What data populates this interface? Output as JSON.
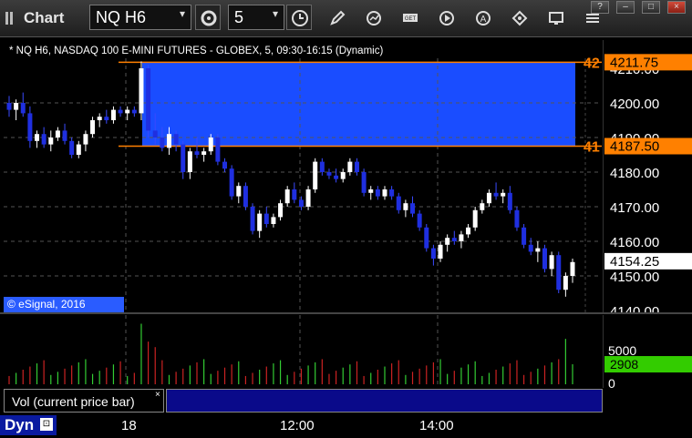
{
  "toolbar": {
    "title": "Chart",
    "symbol": "NQ H6",
    "interval": "5",
    "icons": [
      "settings-gear-icon",
      "clock-icon",
      "pencil-icon",
      "refresh-icon",
      "get-icon",
      "play-icon",
      "alert-icon",
      "tag-icon",
      "monitor-icon",
      "list-icon"
    ]
  },
  "window_buttons": [
    "?",
    "–",
    "□",
    "×"
  ],
  "chart_header": "* NQ H6, NASDAQ 100 E-MINI FUTURES - GLOBEX, 5, 09:30-16:15 (Dynamic)",
  "copyright": "© eSignal, 2016",
  "price_axis": {
    "ticks": [
      "4210.00",
      "4200.00",
      "4190.00",
      "4180.00",
      "4170.00",
      "4160.00",
      "4150.00",
      "4140.00"
    ],
    "markers": [
      {
        "label": "42",
        "value": "4211.75",
        "color": "#ff8000"
      },
      {
        "label": "41",
        "value": "4187.50",
        "color": "#ff8000"
      },
      {
        "label": "",
        "value": "4154.25",
        "color": "#ffffff"
      }
    ]
  },
  "volume_axis": {
    "ticks": [
      "5000",
      "0"
    ],
    "current": "2908",
    "current_color": "#33cc00"
  },
  "volume_study_label": "Vol (current price bar)",
  "study_close": "×",
  "dynamic_label": "Dyn",
  "time_axis": [
    "18",
    "12:00",
    "14:00"
  ],
  "colors": {
    "up_candle": "#ffffff",
    "down_candle": "#1f2fe0",
    "zone": "#1a4dff",
    "level_line": "#ff8000",
    "vol_up": "#33cc33",
    "vol_down": "#cc2222"
  },
  "chart_data": {
    "type": "candlestick",
    "price_range": [
      4140,
      4212
    ],
    "levels": [
      4211.75,
      4187.5
    ],
    "last": 4154.25,
    "candles": [
      [
        4200,
        4202,
        4196,
        4198
      ],
      [
        4198,
        4201,
        4195,
        4200
      ],
      [
        4200,
        4203,
        4196,
        4197
      ],
      [
        4197,
        4199,
        4187,
        4189
      ],
      [
        4189,
        4192,
        4187,
        4191
      ],
      [
        4191,
        4193,
        4187,
        4188
      ],
      [
        4188,
        4192,
        4186,
        4190
      ],
      [
        4190,
        4193,
        4189,
        4192
      ],
      [
        4192,
        4194,
        4188,
        4189
      ],
      [
        4189,
        4190,
        4184,
        4185
      ],
      [
        4185,
        4189,
        4184,
        4188
      ],
      [
        4188,
        4192,
        4186,
        4191
      ],
      [
        4191,
        4196,
        4190,
        4195
      ],
      [
        4195,
        4197,
        4193,
        4196
      ],
      [
        4196,
        4198,
        4194,
        4195
      ],
      [
        4195,
        4199,
        4194,
        4198
      ],
      [
        4198,
        4199,
        4196,
        4197
      ],
      [
        4197,
        4199,
        4195,
        4198
      ],
      [
        4198,
        4199,
        4196,
        4197
      ],
      [
        4197,
        4212,
        4195,
        4210
      ],
      [
        4210,
        4211,
        4190,
        4192
      ],
      [
        4192,
        4197,
        4188,
        4190
      ],
      [
        4190,
        4193,
        4186,
        4187
      ],
      [
        4187,
        4193,
        4185,
        4191
      ],
      [
        4191,
        4192,
        4186,
        4188
      ],
      [
        4188,
        4189,
        4178,
        4180
      ],
      [
        4180,
        4187,
        4178,
        4186
      ],
      [
        4186,
        4190,
        4184,
        4185
      ],
      [
        4185,
        4187,
        4183,
        4186
      ],
      [
        4186,
        4191,
        4185,
        4190
      ],
      [
        4190,
        4191,
        4182,
        4183
      ],
      [
        4183,
        4184,
        4180,
        4181
      ],
      [
        4181,
        4182,
        4172,
        4173
      ],
      [
        4173,
        4177,
        4171,
        4176
      ],
      [
        4176,
        4177,
        4169,
        4170
      ],
      [
        4170,
        4171,
        4162,
        4163
      ],
      [
        4163,
        4169,
        4161,
        4168
      ],
      [
        4168,
        4170,
        4164,
        4165
      ],
      [
        4165,
        4168,
        4164,
        4167
      ],
      [
        4167,
        4172,
        4166,
        4171
      ],
      [
        4171,
        4176,
        4170,
        4175
      ],
      [
        4175,
        4177,
        4171,
        4172
      ],
      [
        4172,
        4173,
        4169,
        4170
      ],
      [
        4170,
        4176,
        4169,
        4175
      ],
      [
        4175,
        4184,
        4174,
        4183
      ],
      [
        4183,
        4184,
        4179,
        4180
      ],
      [
        4180,
        4181,
        4178,
        4179
      ],
      [
        4179,
        4181,
        4177,
        4178
      ],
      [
        4178,
        4181,
        4177,
        4180
      ],
      [
        4180,
        4184,
        4179,
        4183
      ],
      [
        4183,
        4184,
        4179,
        4180
      ],
      [
        4180,
        4181,
        4173,
        4174
      ],
      [
        4174,
        4176,
        4172,
        4175
      ],
      [
        4175,
        4176,
        4172,
        4173
      ],
      [
        4173,
        4176,
        4172,
        4175
      ],
      [
        4175,
        4176,
        4172,
        4173
      ],
      [
        4173,
        4174,
        4168,
        4169
      ],
      [
        4169,
        4172,
        4167,
        4171
      ],
      [
        4171,
        4173,
        4167,
        4168
      ],
      [
        4168,
        4169,
        4163,
        4164
      ],
      [
        4164,
        4165,
        4157,
        4158
      ],
      [
        4158,
        4159,
        4153,
        4155
      ],
      [
        4155,
        4160,
        4154,
        4159
      ],
      [
        4159,
        4162,
        4157,
        4161
      ],
      [
        4161,
        4163,
        4159,
        4160
      ],
      [
        4160,
        4163,
        4158,
        4162
      ],
      [
        4162,
        4165,
        4161,
        4164
      ],
      [
        4164,
        4170,
        4163,
        4169
      ],
      [
        4169,
        4172,
        4168,
        4171
      ],
      [
        4171,
        4175,
        4170,
        4174
      ],
      [
        4174,
        4177,
        4172,
        4173
      ],
      [
        4173,
        4175,
        4171,
        4174
      ],
      [
        4174,
        4176,
        4168,
        4169
      ],
      [
        4169,
        4170,
        4163,
        4164
      ],
      [
        4164,
        4165,
        4158,
        4159
      ],
      [
        4159,
        4161,
        4156,
        4157
      ],
      [
        4157,
        4160,
        4154,
        4158
      ],
      [
        4158,
        4159,
        4151,
        4152
      ],
      [
        4152,
        4157,
        4150,
        4156
      ],
      [
        4156,
        4157,
        4145,
        4146
      ],
      [
        4146,
        4151,
        4144,
        4150
      ],
      [
        4150,
        4155,
        4148,
        4154
      ]
    ],
    "volume_max": 9000,
    "volume_current": 2908
  }
}
